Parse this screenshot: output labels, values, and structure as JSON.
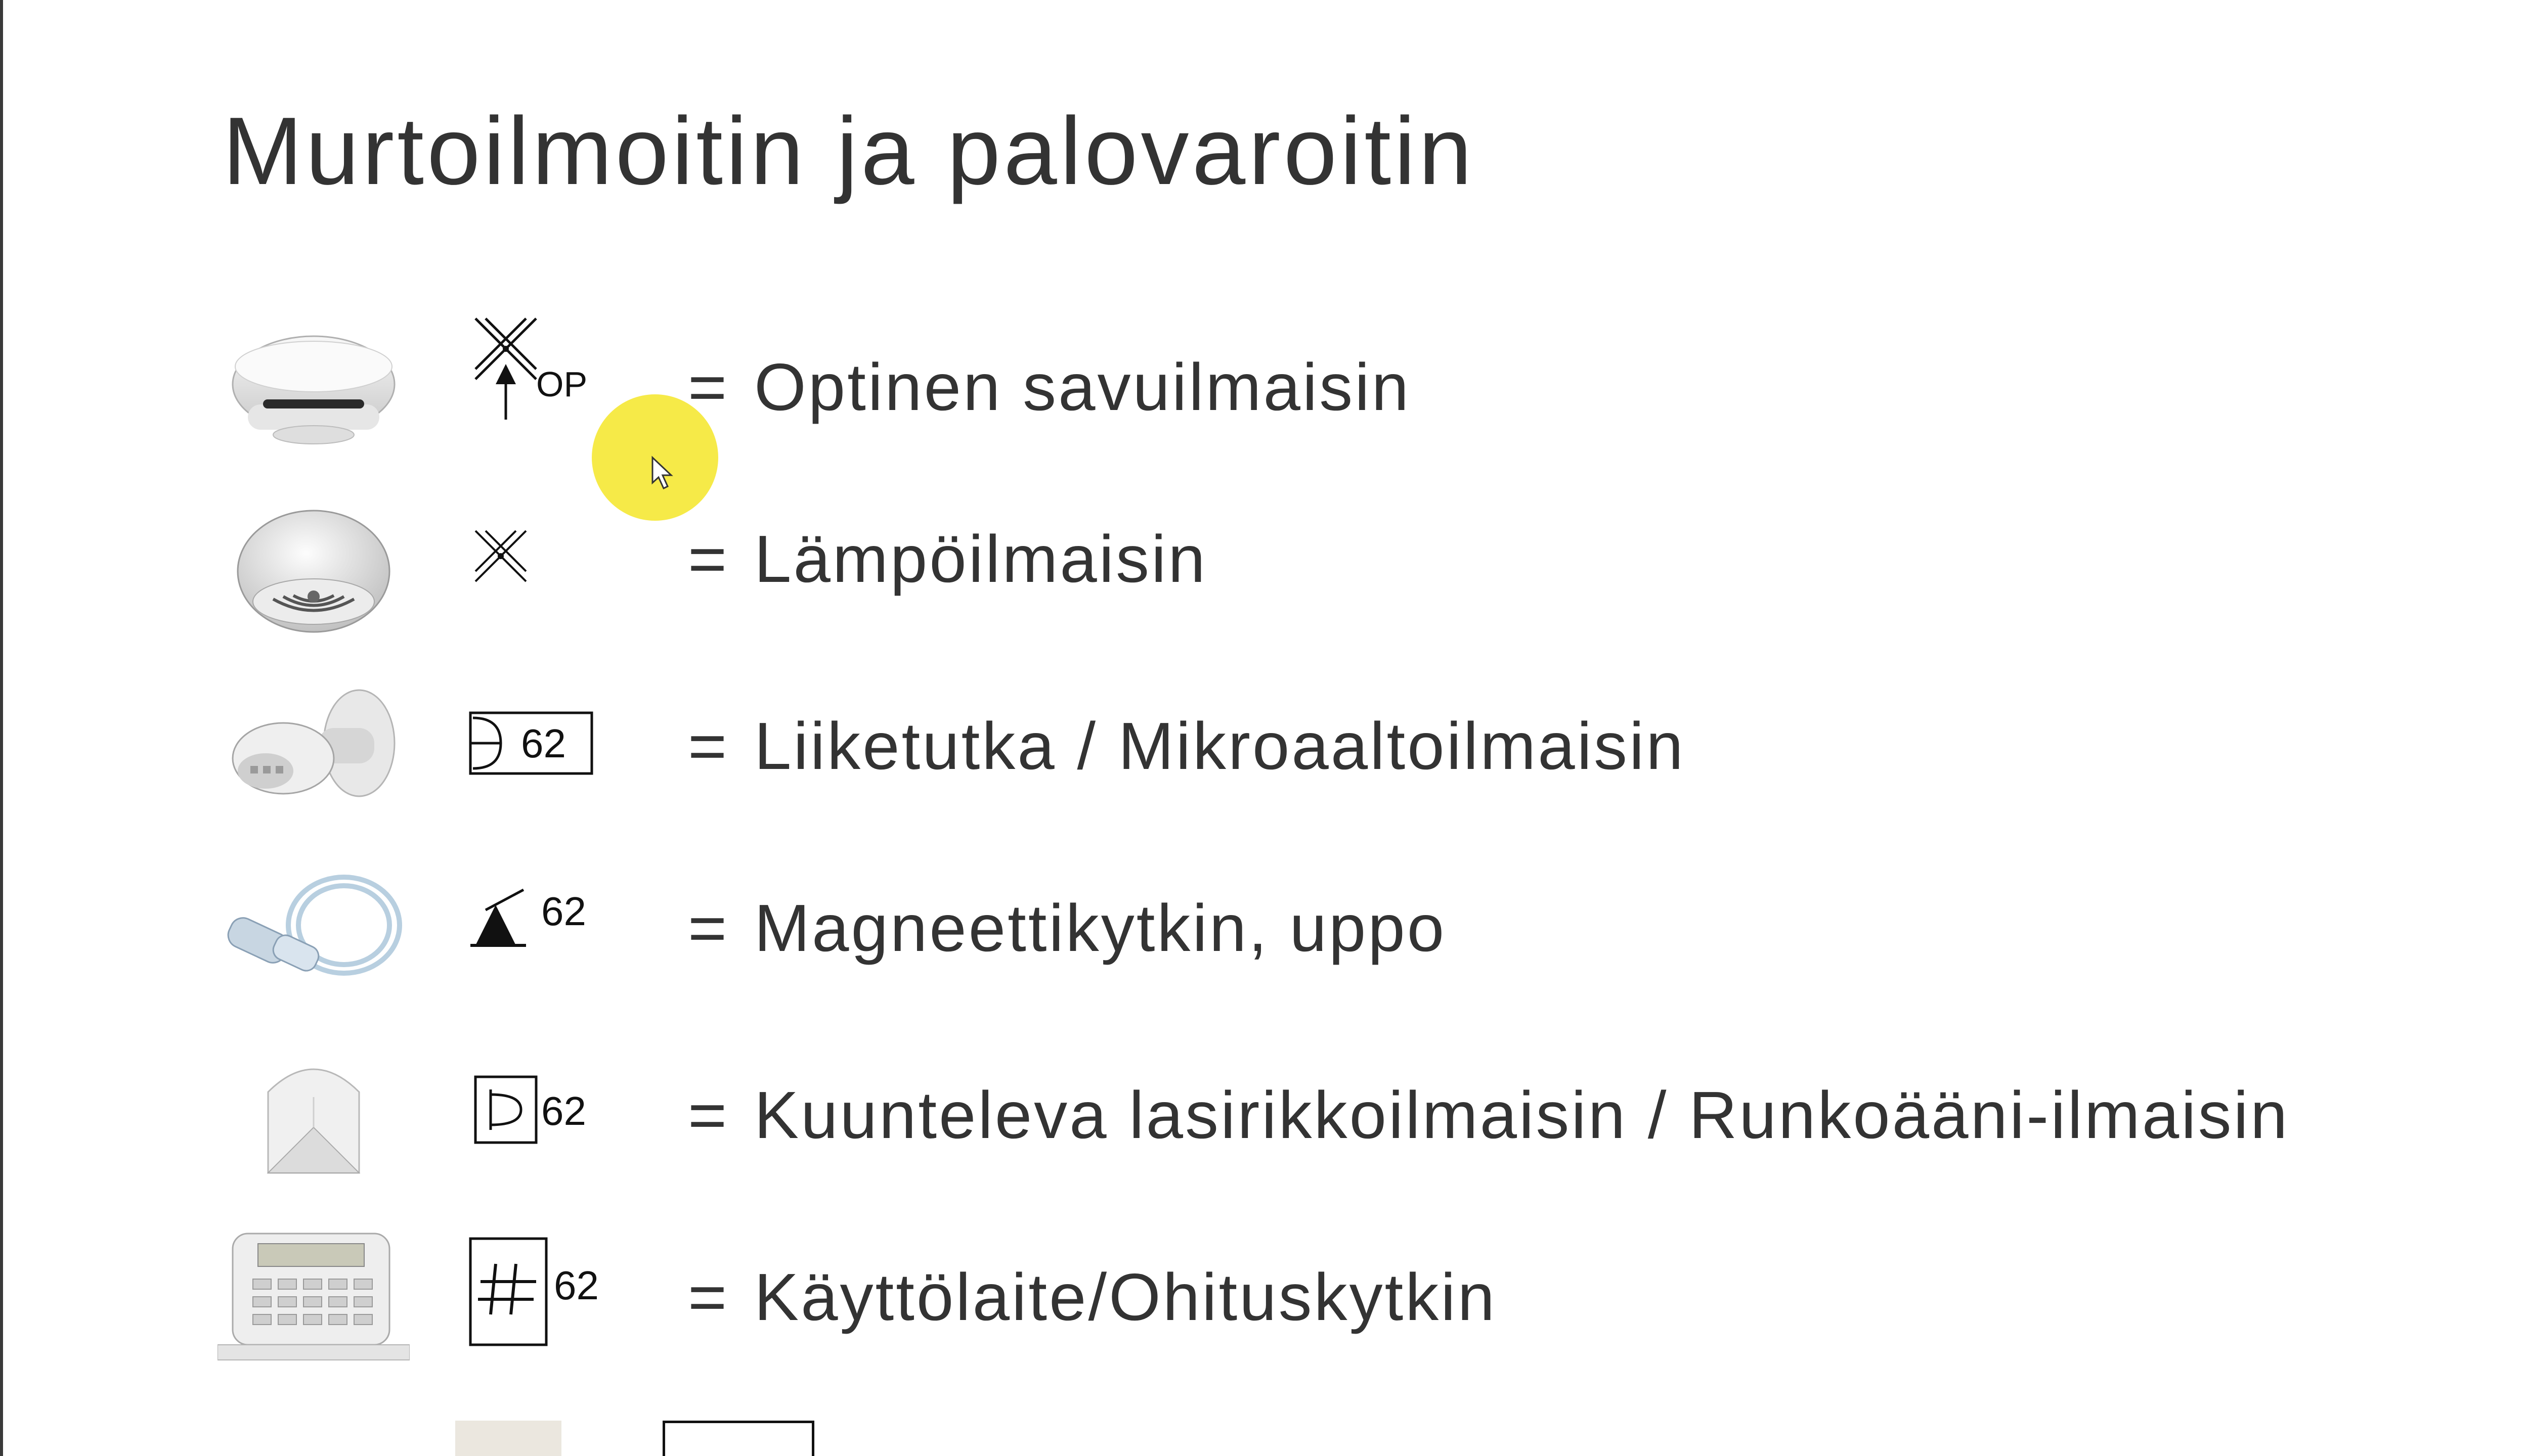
{
  "slide": {
    "title": "Murtoilmoitin ja palovaroitin",
    "items": [
      {
        "photo_icon": "optical-smoke-detector-photo",
        "symbol_icon": "smoke-detector-symbol",
        "symbol_text": "OP",
        "equals": "=",
        "label": "Optinen savuilmaisin"
      },
      {
        "photo_icon": "heat-detector-photo",
        "symbol_icon": "heat-detector-symbol",
        "symbol_text": "",
        "equals": "=",
        "label": "Lämpöilmaisin"
      },
      {
        "photo_icon": "motion-sensor-photo",
        "symbol_icon": "motion-sensor-symbol",
        "symbol_text": "62",
        "equals": "=",
        "label": "Liiketutka / Mikroaaltoilmaisin"
      },
      {
        "photo_icon": "magnetic-switch-photo",
        "symbol_icon": "magnetic-switch-symbol",
        "symbol_text": "62",
        "equals": "=",
        "label": "Magneettikytkin, uppo"
      },
      {
        "photo_icon": "glass-break-detector-photo",
        "symbol_icon": "glass-break-symbol",
        "symbol_text": "62",
        "equals": "=",
        "label": "Kuunteleva lasirikkoilmaisin / Runkoääni-ilmaisin"
      },
      {
        "photo_icon": "keypad-photo",
        "symbol_icon": "keypad-symbol",
        "symbol_text": "62",
        "equals": "=",
        "label": "Käyttölaite/Ohituskytkin"
      }
    ]
  },
  "colors": {
    "text": "#333333",
    "cursor_highlight": "#f4e628"
  }
}
